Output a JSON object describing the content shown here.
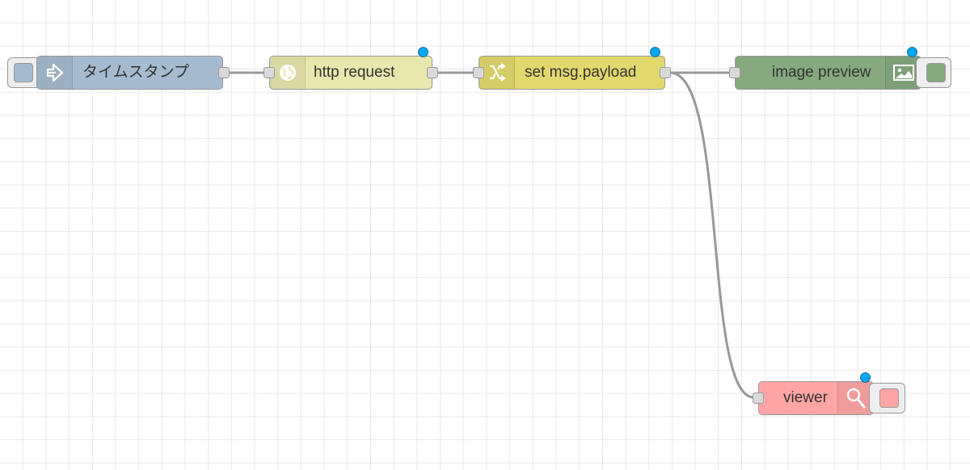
{
  "flow": {
    "nodes": [
      {
        "id": "inject",
        "label": "タイムスタンプ",
        "type": "inject",
        "color": "#a6bbcf",
        "icon": "arrow-in-icon"
      },
      {
        "id": "http",
        "label": "http request",
        "type": "http request",
        "color": "#e7e7ae",
        "icon": "globe-icon"
      },
      {
        "id": "change",
        "label": "set msg.payload",
        "type": "change",
        "color": "#e2d96e",
        "icon": "shuffle-icon"
      },
      {
        "id": "preview",
        "label": "image preview",
        "type": "image",
        "color": "#87a980",
        "icon": "image-icon"
      },
      {
        "id": "debug",
        "label": "viewer",
        "type": "debug",
        "color": "#ffa5a5",
        "icon": "magnifier-icon"
      }
    ],
    "status_color": "#00a8f0",
    "wire_color": "#999999"
  }
}
